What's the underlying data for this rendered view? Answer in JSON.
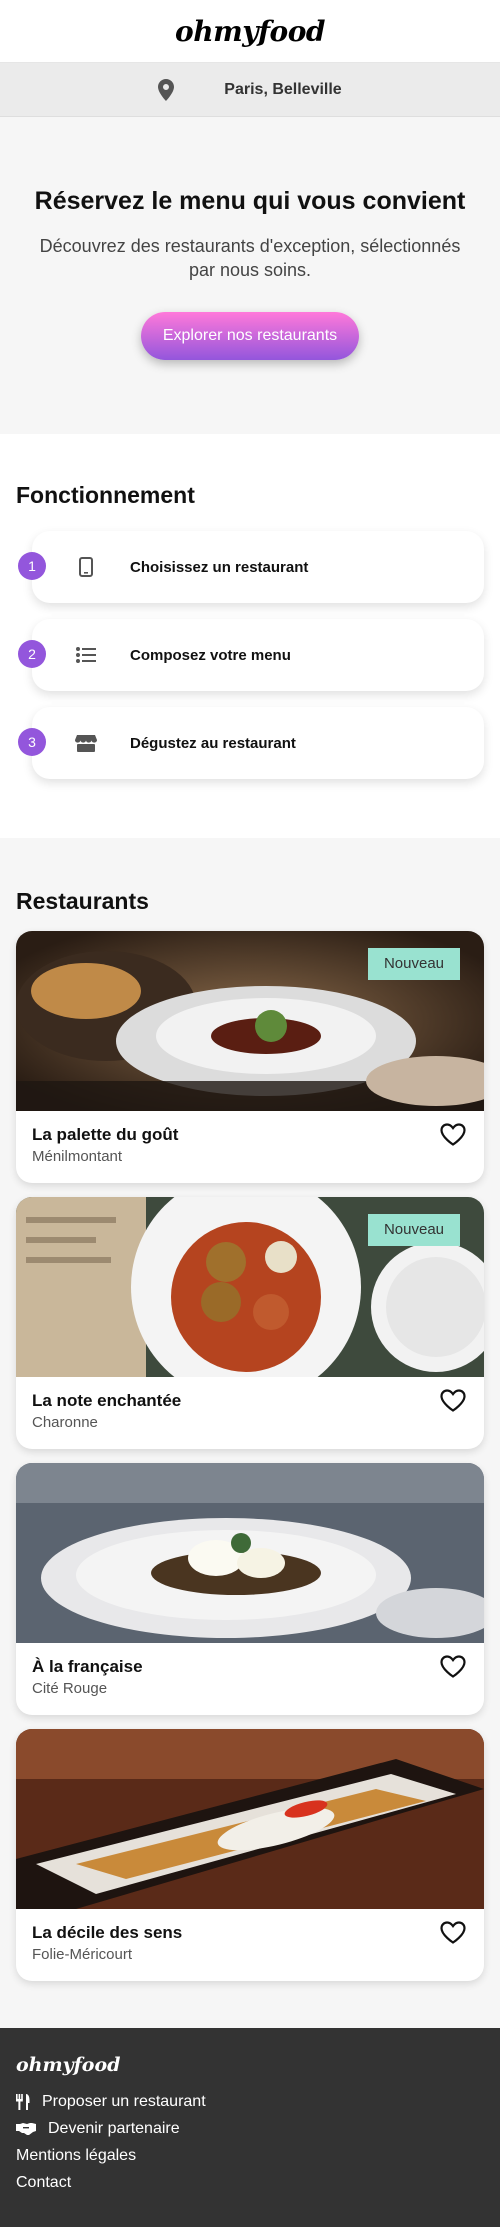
{
  "header": {
    "logo": "ohmyfood"
  },
  "location": {
    "icon": "map-marker-icon",
    "text": "Paris, Belleville"
  },
  "hero": {
    "title": "Réservez le menu qui vous convient",
    "subtitle": "Découvrez des restaurants d'exception, sélectionnés par nous soins.",
    "cta_label": "Explorer nos restaurants"
  },
  "how": {
    "title": "Fonctionnement",
    "steps": [
      {
        "number": "1",
        "icon": "mobile-phone-icon",
        "label": "Choisissez un restaurant"
      },
      {
        "number": "2",
        "icon": "list-icon",
        "label": "Composez votre menu"
      },
      {
        "number": "3",
        "icon": "store-icon",
        "label": "Dégustez au restaurant"
      }
    ]
  },
  "restaurants": {
    "title": "Restaurants",
    "items": [
      {
        "name": "La palette du goût",
        "area": "Ménilmontant",
        "badge": "Nouveau",
        "image": "plated-dish-photo"
      },
      {
        "name": "La note enchantée",
        "area": "Charonne",
        "badge": "Nouveau",
        "image": "meatballs-plate-photo"
      },
      {
        "name": "À la française",
        "area": "Cité Rouge",
        "badge": "",
        "image": "poached-egg-toast-photo"
      },
      {
        "name": "La décile des sens",
        "area": "Folie-Méricourt",
        "badge": "",
        "image": "fish-platter-photo"
      }
    ]
  },
  "footer": {
    "logo": "ohmyfood",
    "links": [
      {
        "icon": "utensils-icon",
        "label": "Proposer un restaurant"
      },
      {
        "icon": "handshake-icon",
        "label": "Devenir partenaire"
      },
      {
        "icon": "",
        "label": "Mentions légales"
      },
      {
        "icon": "",
        "label": "Contact"
      }
    ]
  },
  "colors": {
    "accent_start": "#ff79da",
    "accent_end": "#9356dc",
    "badge": "#99e2d0",
    "footer_bg": "#333333"
  }
}
